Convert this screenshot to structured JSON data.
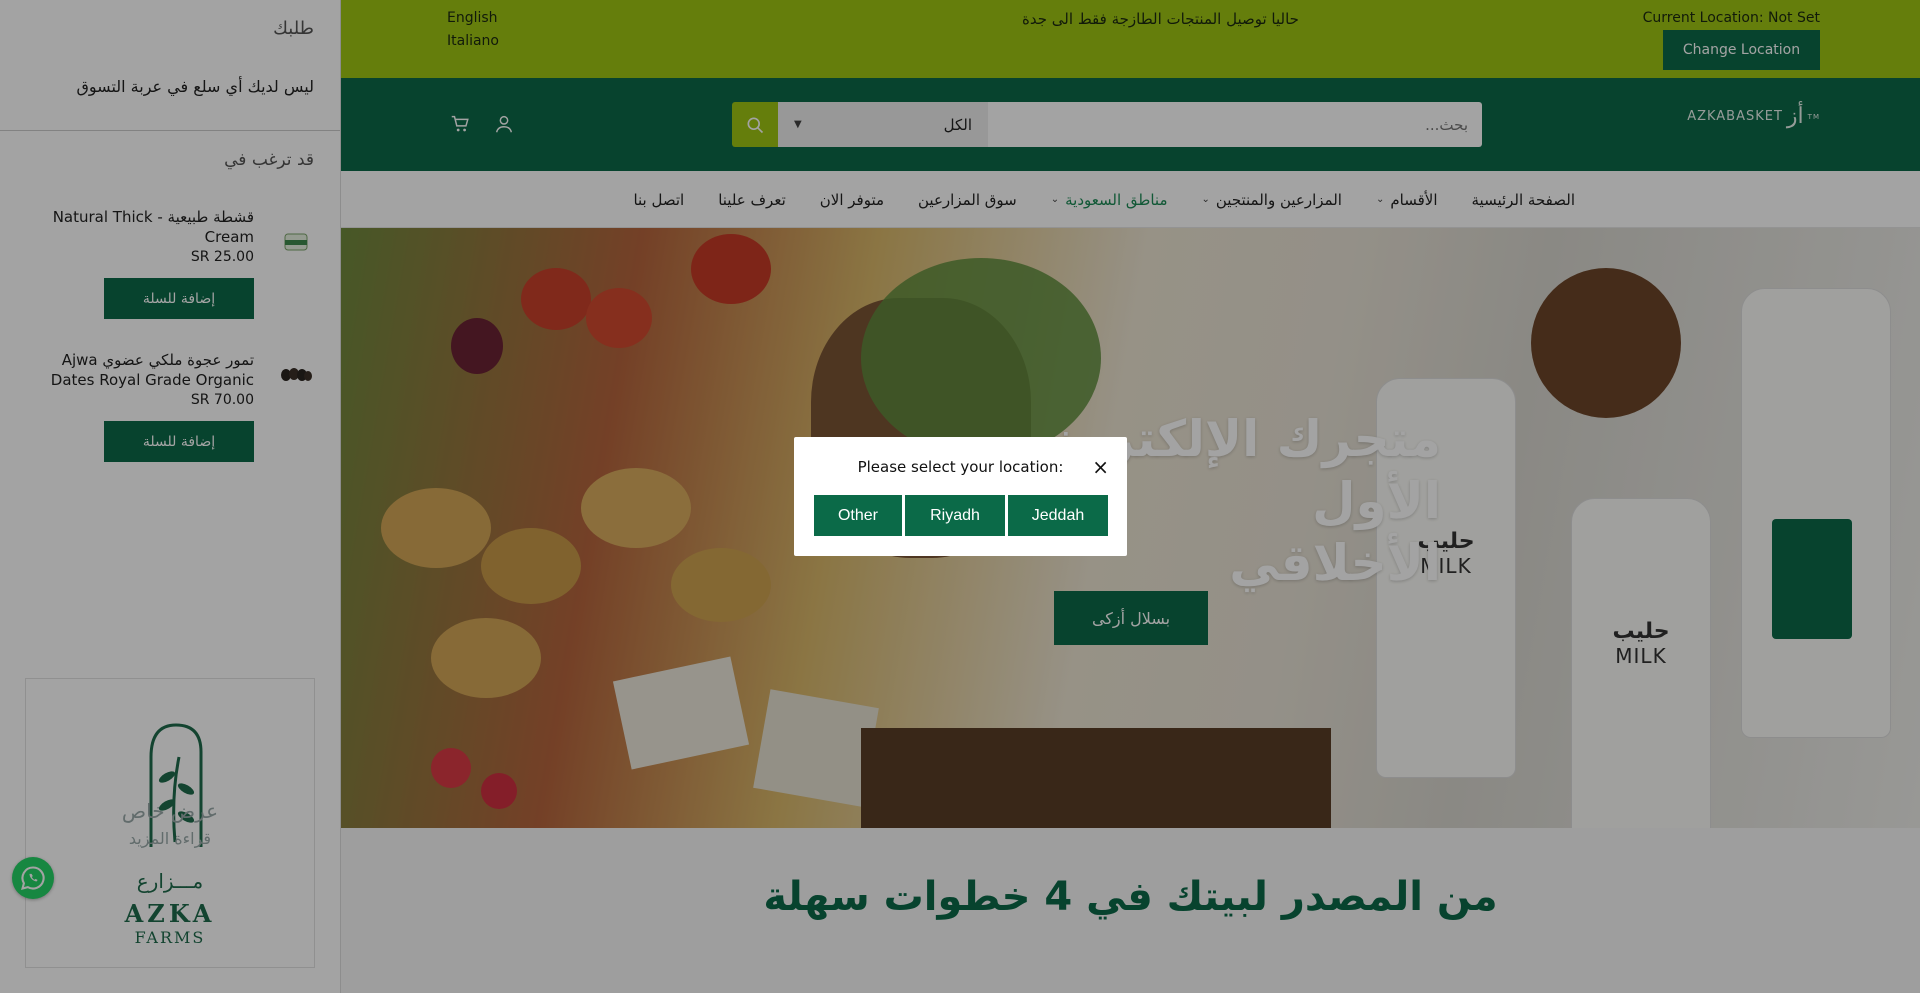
{
  "drawer": {
    "title": "طلبك",
    "empty_text": "ليس لديك أي سلع في عربة التسوق",
    "suggest_title": "قد ترغب في",
    "products": [
      {
        "name": "قشطة طبيعية - Natural Thick Cream",
        "price": "SR 25.00",
        "add_label": "إضافة للسلة"
      },
      {
        "name": "تمور عجوة ملكي عضوي Ajwa Dates Royal Grade Organic",
        "price": "SR 70.00",
        "add_label": "إضافة للسلة"
      }
    ],
    "promo": {
      "line1": "عرض خاص",
      "line2": "قراءة المزيد",
      "brand_ar": "مـــزارع",
      "brand_en": "AZKA",
      "brand_sub": "FARMS"
    }
  },
  "topbar": {
    "lang_en": "English",
    "lang_it": "Italiano",
    "announcement": "حاليا توصيل المنتجات الطازجة فقط الى جدة",
    "location_label": "Current Location: Not Set",
    "change_location": "Change Location"
  },
  "header": {
    "logo_text": "AZKABASKET",
    "logo_mark": "TM",
    "search_placeholder": "بحث...",
    "category": "الكل"
  },
  "nav": {
    "items": [
      {
        "label": "الصفحة الرئيسية",
        "dropdown": false
      },
      {
        "label": "الأقسام",
        "dropdown": true
      },
      {
        "label": "المزارعين والمنتجين",
        "dropdown": true
      },
      {
        "label": "مناطق السعودية",
        "dropdown": true,
        "active": true
      },
      {
        "label": "سوق المزارعين",
        "dropdown": false
      },
      {
        "label": "متوفر الان",
        "dropdown": false
      },
      {
        "label": "تعرف علينا",
        "dropdown": false
      },
      {
        "label": "اتصل بنا",
        "dropdown": false
      }
    ]
  },
  "hero": {
    "title_line1": "متجرك الإلكتروني الأول",
    "title_line2": "الأخلاقي",
    "button": "بسلال أزكى",
    "milk_ar": "حليب",
    "milk_en": "MILK"
  },
  "steps_heading": "من المصدر لبيتك في 4 خطوات سهلة",
  "modal": {
    "title": "Please select your location:",
    "close": "×",
    "options": [
      "Other",
      "Riyadh",
      "Jeddah"
    ]
  },
  "colors": {
    "brand_green": "#0b6a48",
    "lime": "#9fc514",
    "overlay": "rgba(0,0,0,0.36)"
  }
}
